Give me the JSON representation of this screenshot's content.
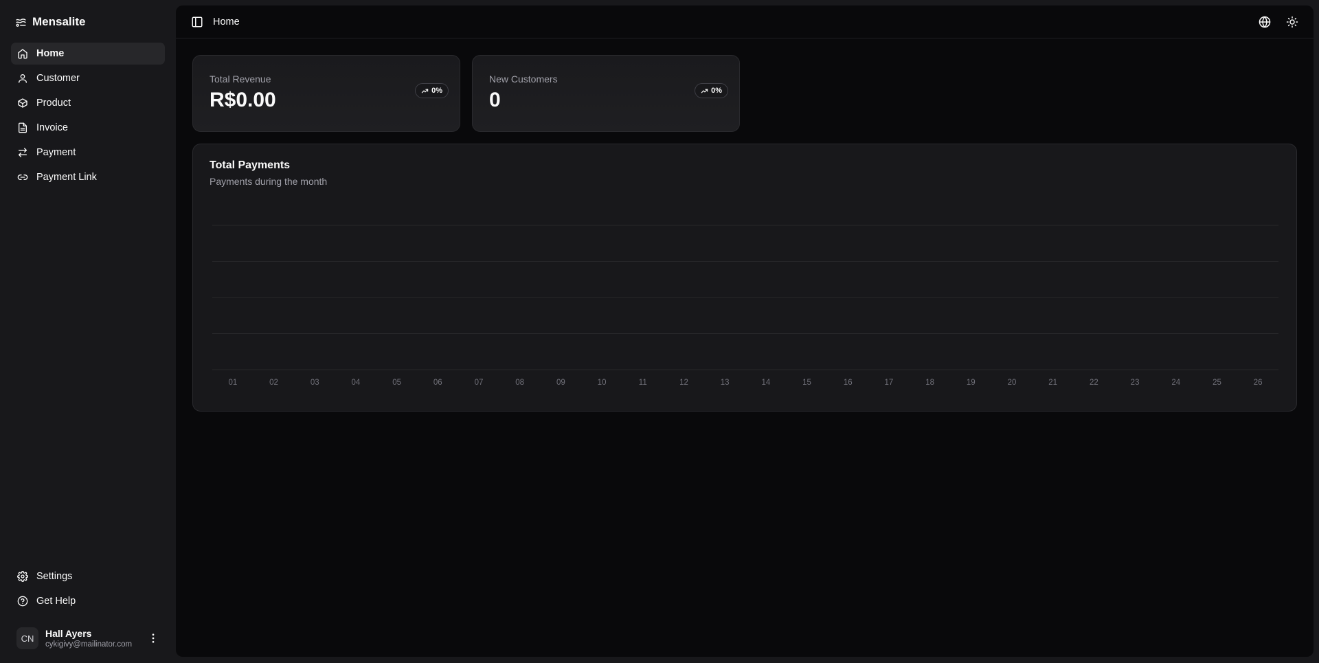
{
  "brand": {
    "name": "Mensalite"
  },
  "sidebar": {
    "items": [
      {
        "label": "Home",
        "icon": "home-icon",
        "active": true
      },
      {
        "label": "Customer",
        "icon": "user-icon",
        "active": false
      },
      {
        "label": "Product",
        "icon": "box-icon",
        "active": false
      },
      {
        "label": "Invoice",
        "icon": "file-icon",
        "active": false
      },
      {
        "label": "Payment",
        "icon": "arrows-icon",
        "active": false
      },
      {
        "label": "Payment Link",
        "icon": "link-icon",
        "active": false
      }
    ],
    "bottom": [
      {
        "label": "Settings",
        "icon": "gear-icon"
      },
      {
        "label": "Get Help",
        "icon": "help-icon"
      }
    ],
    "user": {
      "initials": "CN",
      "name": "Hall Ayers",
      "email": "cykigivy@mailinator.com"
    }
  },
  "header": {
    "breadcrumb": "Home"
  },
  "cards": [
    {
      "label": "Total Revenue",
      "value": "R$0.00",
      "badge": "0%"
    },
    {
      "label": "New Customers",
      "value": "0",
      "badge": "0%"
    }
  ],
  "chart": {
    "title": "Total Payments",
    "subtitle": "Payments during the month"
  },
  "chart_data": {
    "type": "bar",
    "categories": [
      "01",
      "02",
      "03",
      "04",
      "05",
      "06",
      "07",
      "08",
      "09",
      "10",
      "11",
      "12",
      "13",
      "14",
      "15",
      "16",
      "17",
      "18",
      "19",
      "20",
      "21",
      "22",
      "23",
      "24",
      "25",
      "26"
    ],
    "values": [
      0,
      0,
      0,
      0,
      0,
      0,
      0,
      0,
      0,
      0,
      0,
      0,
      0,
      0,
      0,
      0,
      0,
      0,
      0,
      0,
      0,
      0,
      0,
      0,
      0,
      0
    ],
    "title": "Total Payments",
    "subtitle": "Payments during the month",
    "xlabel": "",
    "ylabel": "",
    "grid": true,
    "colors": {
      "bar": "#fafafa",
      "grid": "#27272a"
    }
  }
}
